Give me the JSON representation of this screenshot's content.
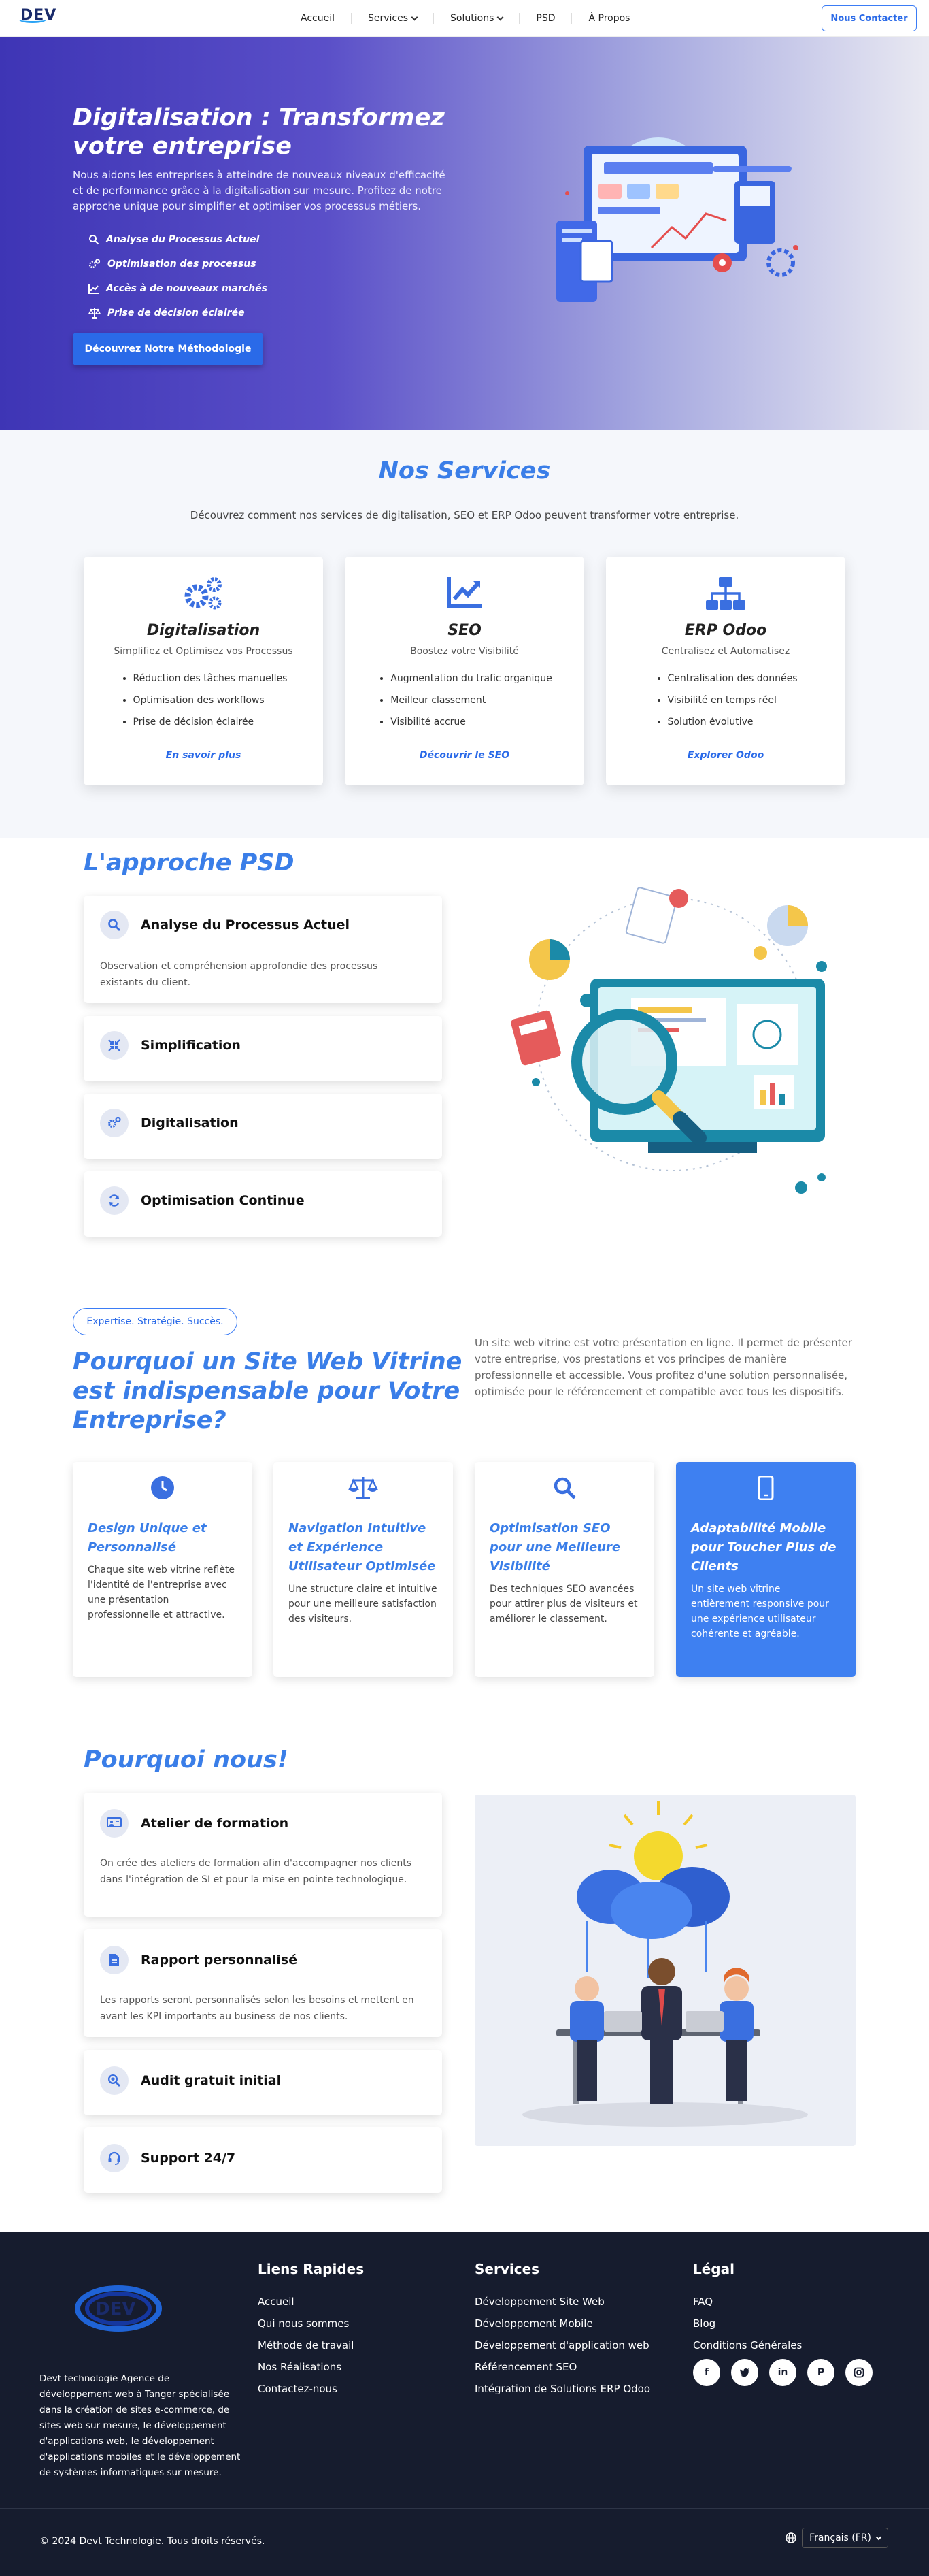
{
  "nav": {
    "logo": "DEV",
    "links": [
      "Accueil",
      "Services",
      "Solutions",
      "PSD",
      "À Propos"
    ],
    "contact_label": "Nous Contacter"
  },
  "hero": {
    "title": "Digitalisation : Transformez votre entreprise",
    "lead": "Nous aidons les entreprises à atteindre de nouveaux niveaux d'efficacité et de performance grâce à la digitalisation sur mesure. Profitez de notre approche unique pour simplifier et optimiser vos processus métiers.",
    "features": [
      "Analyse du Processus Actuel",
      "Optimisation des processus",
      "Accès à de nouveaux marchés",
      "Prise de décision éclairée"
    ],
    "cta": "Découvrez Notre Méthodologie"
  },
  "services": {
    "title": "Nos Services",
    "intro": "Découvrez comment nos services de digitalisation, SEO et ERP Odoo peuvent transformer votre entreprise.",
    "cards": [
      {
        "title": "Digitalisation",
        "subtitle": "Simplifiez et Optimisez vos Processus",
        "items": [
          "Réduction des tâches manuelles",
          "Optimisation des workflows",
          "Prise de décision éclairée"
        ],
        "link": "En savoir plus"
      },
      {
        "title": "SEO",
        "subtitle": "Boostez votre Visibilité",
        "items": [
          "Augmentation du trafic organique",
          "Meilleur classement",
          "Visibilité accrue"
        ],
        "link": "Découvrir le SEO"
      },
      {
        "title": "ERP Odoo",
        "subtitle": "Centralisez et Automatisez",
        "items": [
          "Centralisation des données",
          "Visibilité en temps réel",
          "Solution évolutive"
        ],
        "link": "Explorer Odoo"
      }
    ]
  },
  "psd": {
    "title": "L'approche PSD",
    "steps": [
      {
        "title": "Analyse du Processus Actuel",
        "body": "Observation et compréhension approfondie des processus existants du client."
      },
      {
        "title": "Simplification",
        "body": ""
      },
      {
        "title": "Digitalisation",
        "body": ""
      },
      {
        "title": "Optimisation Continue",
        "body": ""
      }
    ]
  },
  "vitrine": {
    "pill": "Expertise. Stratégie. Succès.",
    "title": "Pourquoi un Site Web Vitrine est indispensable pour Votre Entreprise?",
    "text": "Un site web vitrine est votre présentation en ligne. Il permet de présenter votre entreprise, vos prestations et vos principes de manière professionnelle et accessible. Vous profitez d'une solution personnalisée, optimisée pour le référencement et compatible avec tous les dispositifs.",
    "cards": [
      {
        "title": "Design Unique et Personnalisé",
        "body": "Chaque site web vitrine reflète l'identité de l'entreprise avec une présentation professionnelle et attractive."
      },
      {
        "title": "Navigation Intuitive et Expérience Utilisateur Optimisée",
        "body": "Une structure claire et intuitive pour une meilleure satisfaction des visiteurs."
      },
      {
        "title": "Optimisation SEO pour une Meilleure Visibilité",
        "body": "Des techniques SEO avancées pour attirer plus de visiteurs et améliorer le classement."
      },
      {
        "title": "Adaptabilité Mobile pour Toucher Plus de Clients",
        "body": "Un site web vitrine entièrement responsive pour une expérience utilisateur cohérente et agréable."
      }
    ]
  },
  "why": {
    "title": "Pourquoi nous!",
    "items": [
      {
        "title": "Atelier de formation",
        "body": "On crée des ateliers de formation afin d'accompagner nos clients dans l'intégration de SI et pour la mise en pointe technologique."
      },
      {
        "title": "Rapport personnalisé",
        "body": "Les rapports seront personnalisés selon les besoins et mettent en avant les KPI importants au business de nos clients."
      },
      {
        "title": "Audit gratuit initial",
        "body": ""
      },
      {
        "title": "Support 24/7",
        "body": ""
      }
    ]
  },
  "footer": {
    "logo": "DEV",
    "description": "Devt technologie Agence de développement web à Tanger spécialisée dans la création de sites e-commerce, de sites web sur mesure, le développement d'applications web, le développement d'applications mobiles et le développement de systèmes informatiques sur mesure.",
    "quick_title": "Liens Rapides",
    "quick_links": [
      "Accueil",
      "Qui nous sommes",
      "Méthode de travail",
      "Nos Réalisations",
      "Contactez-nous"
    ],
    "services_title": "Services",
    "services_links": [
      "Développement Site Web",
      "Développement Mobile",
      "Développement d'application web",
      "Référencement SEO",
      "Intégration de Solutions ERP Odoo"
    ],
    "legal_title": "Légal",
    "legal_links": [
      "FAQ",
      "Blog",
      "Conditions Générales"
    ],
    "copyright": "© 2024 Devt Technologie. Tous droits réservés.",
    "language": "Français (FR)"
  }
}
